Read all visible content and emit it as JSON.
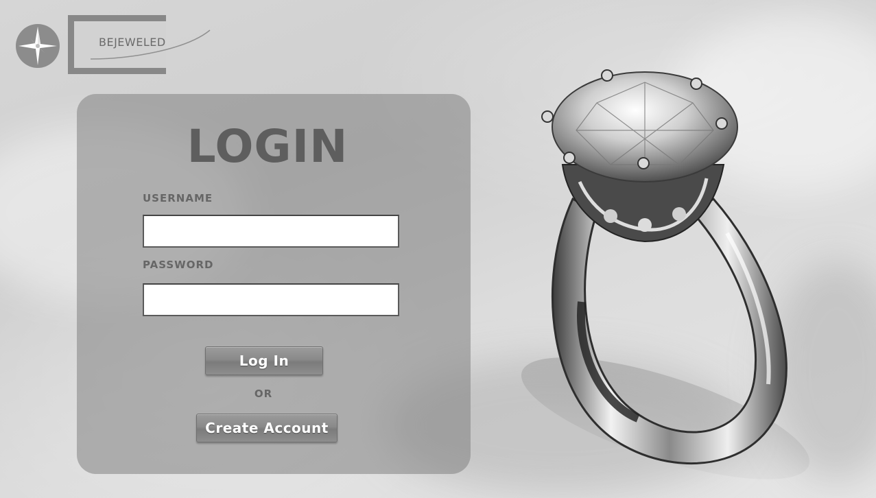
{
  "brand": {
    "name": "BEJEWELED",
    "logo_icon": "compass-star-icon"
  },
  "login": {
    "title": "LOGIN",
    "username_label": "USERNAME",
    "username_value": "",
    "password_label": "PASSWORD",
    "password_value": "",
    "login_button": "Log In",
    "or_text": "OR",
    "create_account_button": "Create Account"
  },
  "hero": {
    "image": "diamond-ring-photo"
  },
  "colors": {
    "panel": "#8a8a8a",
    "title": "#5e5e5e",
    "button": "#8a8a8a",
    "background": "#d6d6d6"
  }
}
